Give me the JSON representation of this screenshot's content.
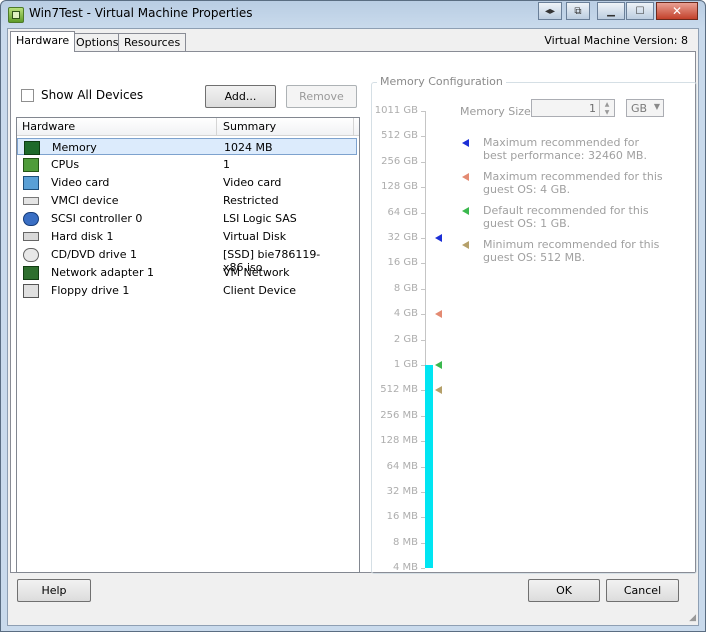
{
  "window": {
    "title": "Win7Test - Virtual Machine Properties",
    "vm_version": "Virtual Machine Version: 8"
  },
  "titlebar_buttons": [
    {
      "icon": "nav-arrows-icon",
      "glyph": "◂▸"
    },
    {
      "icon": "restore-alt-icon",
      "glyph": "⧉"
    },
    {
      "icon": "minimize-icon",
      "glyph": "▁"
    },
    {
      "icon": "maximize-icon",
      "glyph": "☐"
    },
    {
      "icon": "close-icon",
      "glyph": "✕"
    }
  ],
  "tabs": [
    {
      "label": "Hardware",
      "active": true
    },
    {
      "label": "Options",
      "active": false
    },
    {
      "label": "Resources",
      "active": false
    }
  ],
  "toolbar": {
    "show_all_devices": "Show All Devices",
    "add_label": "Add...",
    "remove_label": "Remove"
  },
  "device_list": {
    "col_hardware": "Hardware",
    "col_summary": "Summary",
    "rows": [
      {
        "name": "Memory",
        "summary": "1024 MB",
        "icon": "memory-icon",
        "selected": true
      },
      {
        "name": "CPUs",
        "summary": "1",
        "icon": "cpu-icon",
        "selected": false
      },
      {
        "name": "Video card",
        "summary": "Video card",
        "icon": "video-card-icon",
        "selected": false
      },
      {
        "name": "VMCI device",
        "summary": "Restricted",
        "icon": "vmci-device-icon",
        "selected": false
      },
      {
        "name": "SCSI controller 0",
        "summary": "LSI Logic SAS",
        "icon": "scsi-controller-icon",
        "selected": false
      },
      {
        "name": "Hard disk 1",
        "summary": "Virtual Disk",
        "icon": "hard-disk-icon",
        "selected": false
      },
      {
        "name": "CD/DVD drive 1",
        "summary": "[SSD] bie786119-x86.iso",
        "icon": "cd-dvd-icon",
        "selected": false
      },
      {
        "name": "Network adapter 1",
        "summary": "VM Network",
        "icon": "network-adapter-icon",
        "selected": false
      },
      {
        "name": "Floppy drive 1",
        "summary": "Client Device",
        "icon": "floppy-drive-icon",
        "selected": false
      }
    ]
  },
  "memory_config": {
    "group_title": "Memory Configuration",
    "size_label": "Memory Size:",
    "size_value": "1",
    "unit": "GB",
    "scale_ticks": [
      "1011 GB",
      "512 GB",
      "256 GB",
      "128 GB",
      "64 GB",
      "32 GB",
      "16 GB",
      "8 GB",
      "4 GB",
      "2 GB",
      "1 GB",
      "512 MB",
      "256 MB",
      "128 MB",
      "64 MB",
      "32 MB",
      "16 MB",
      "8 MB",
      "4 MB"
    ],
    "current_level_tick": "1 GB",
    "bar_color": "#00e5f2",
    "markers": [
      {
        "tick": "32 GB",
        "color": "#1c2fd6",
        "text": "Maximum recommended for best performance: 32460 MB."
      },
      {
        "tick": "4 GB",
        "color": "#e38a72",
        "text": "Maximum recommended for this guest OS: 4 GB."
      },
      {
        "tick": "1 GB",
        "color": "#3bb84e",
        "text": "Default recommended for this guest OS: 1 GB."
      },
      {
        "tick": "512 MB",
        "color": "#b5a06a",
        "text": "Minimum recommended for this guest OS: 512 MB."
      }
    ]
  },
  "footer": {
    "help_label": "Help",
    "ok_label": "OK",
    "cancel_label": "Cancel"
  }
}
